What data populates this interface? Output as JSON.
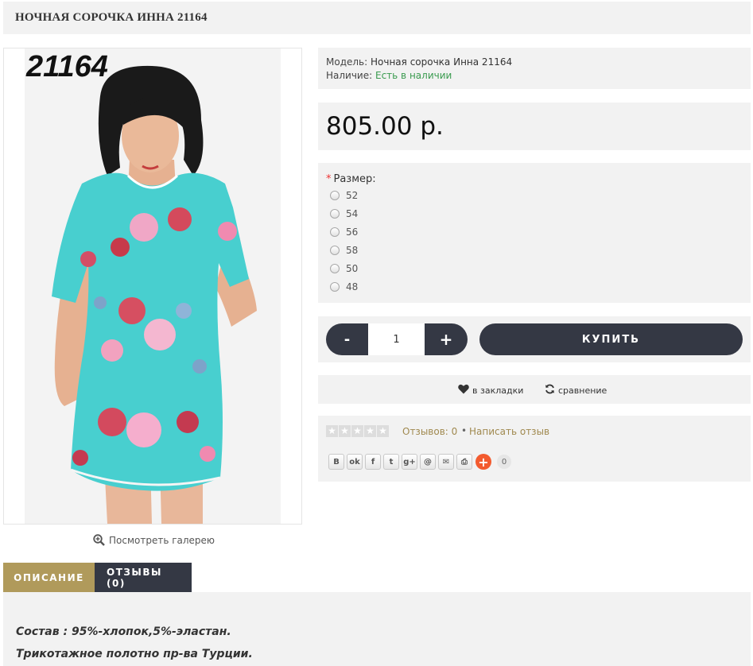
{
  "product": {
    "title": "НОЧНАЯ СОРОЧКА ИННА 21164",
    "photo_code": "21164"
  },
  "gallery": {
    "label": "Посмотреть галерею",
    "icon": "zoom-in-icon"
  },
  "info": {
    "model_label": "Модель:",
    "model_value": "Ночная сорочка Инна 21164",
    "stock_label": "Наличие:",
    "stock_value": "Есть в наличии",
    "stock_color": "#3a9b4f"
  },
  "price": {
    "value": "805.00 р."
  },
  "options": {
    "required_mark": "*",
    "size_label": "Размер:",
    "sizes": [
      "52",
      "54",
      "56",
      "58",
      "50",
      "48"
    ]
  },
  "cart": {
    "minus_label": "-",
    "quantity": "1",
    "plus_label": "+",
    "buy_label": "КУПИТЬ",
    "button_color": "#343844"
  },
  "wishlist": {
    "bookmark_label": "в закладки",
    "bookmark_icon": "heart-icon",
    "compare_label": "сравнение",
    "compare_icon": "refresh-icon"
  },
  "reviews": {
    "rating": 0,
    "max_rating": 5,
    "count_label": "Отзывов: 0",
    "separator": "•",
    "write_label": "Написать отзыв",
    "link_color": "#a0894f"
  },
  "share": {
    "buttons": [
      {
        "name": "vk",
        "glyph": "B"
      },
      {
        "name": "odnoklassniki",
        "glyph": "ok"
      },
      {
        "name": "facebook",
        "glyph": "f"
      },
      {
        "name": "twitter",
        "glyph": "t"
      },
      {
        "name": "google-plus",
        "glyph": "g+"
      },
      {
        "name": "mail-ru",
        "glyph": "@"
      },
      {
        "name": "email",
        "glyph": "✉"
      },
      {
        "name": "print",
        "glyph": "⎙"
      }
    ],
    "more_glyph": "+",
    "count": "0"
  },
  "tabs": {
    "description": "ОПИСАНИЕ",
    "reviews": "ОТЗЫВЫ (0)",
    "active_color": "#b09a5b"
  },
  "description": {
    "line1": "Состав : 95%-хлопок,5%-эластан.",
    "line2": "Трикотажное полотно пр-ва Турции."
  }
}
